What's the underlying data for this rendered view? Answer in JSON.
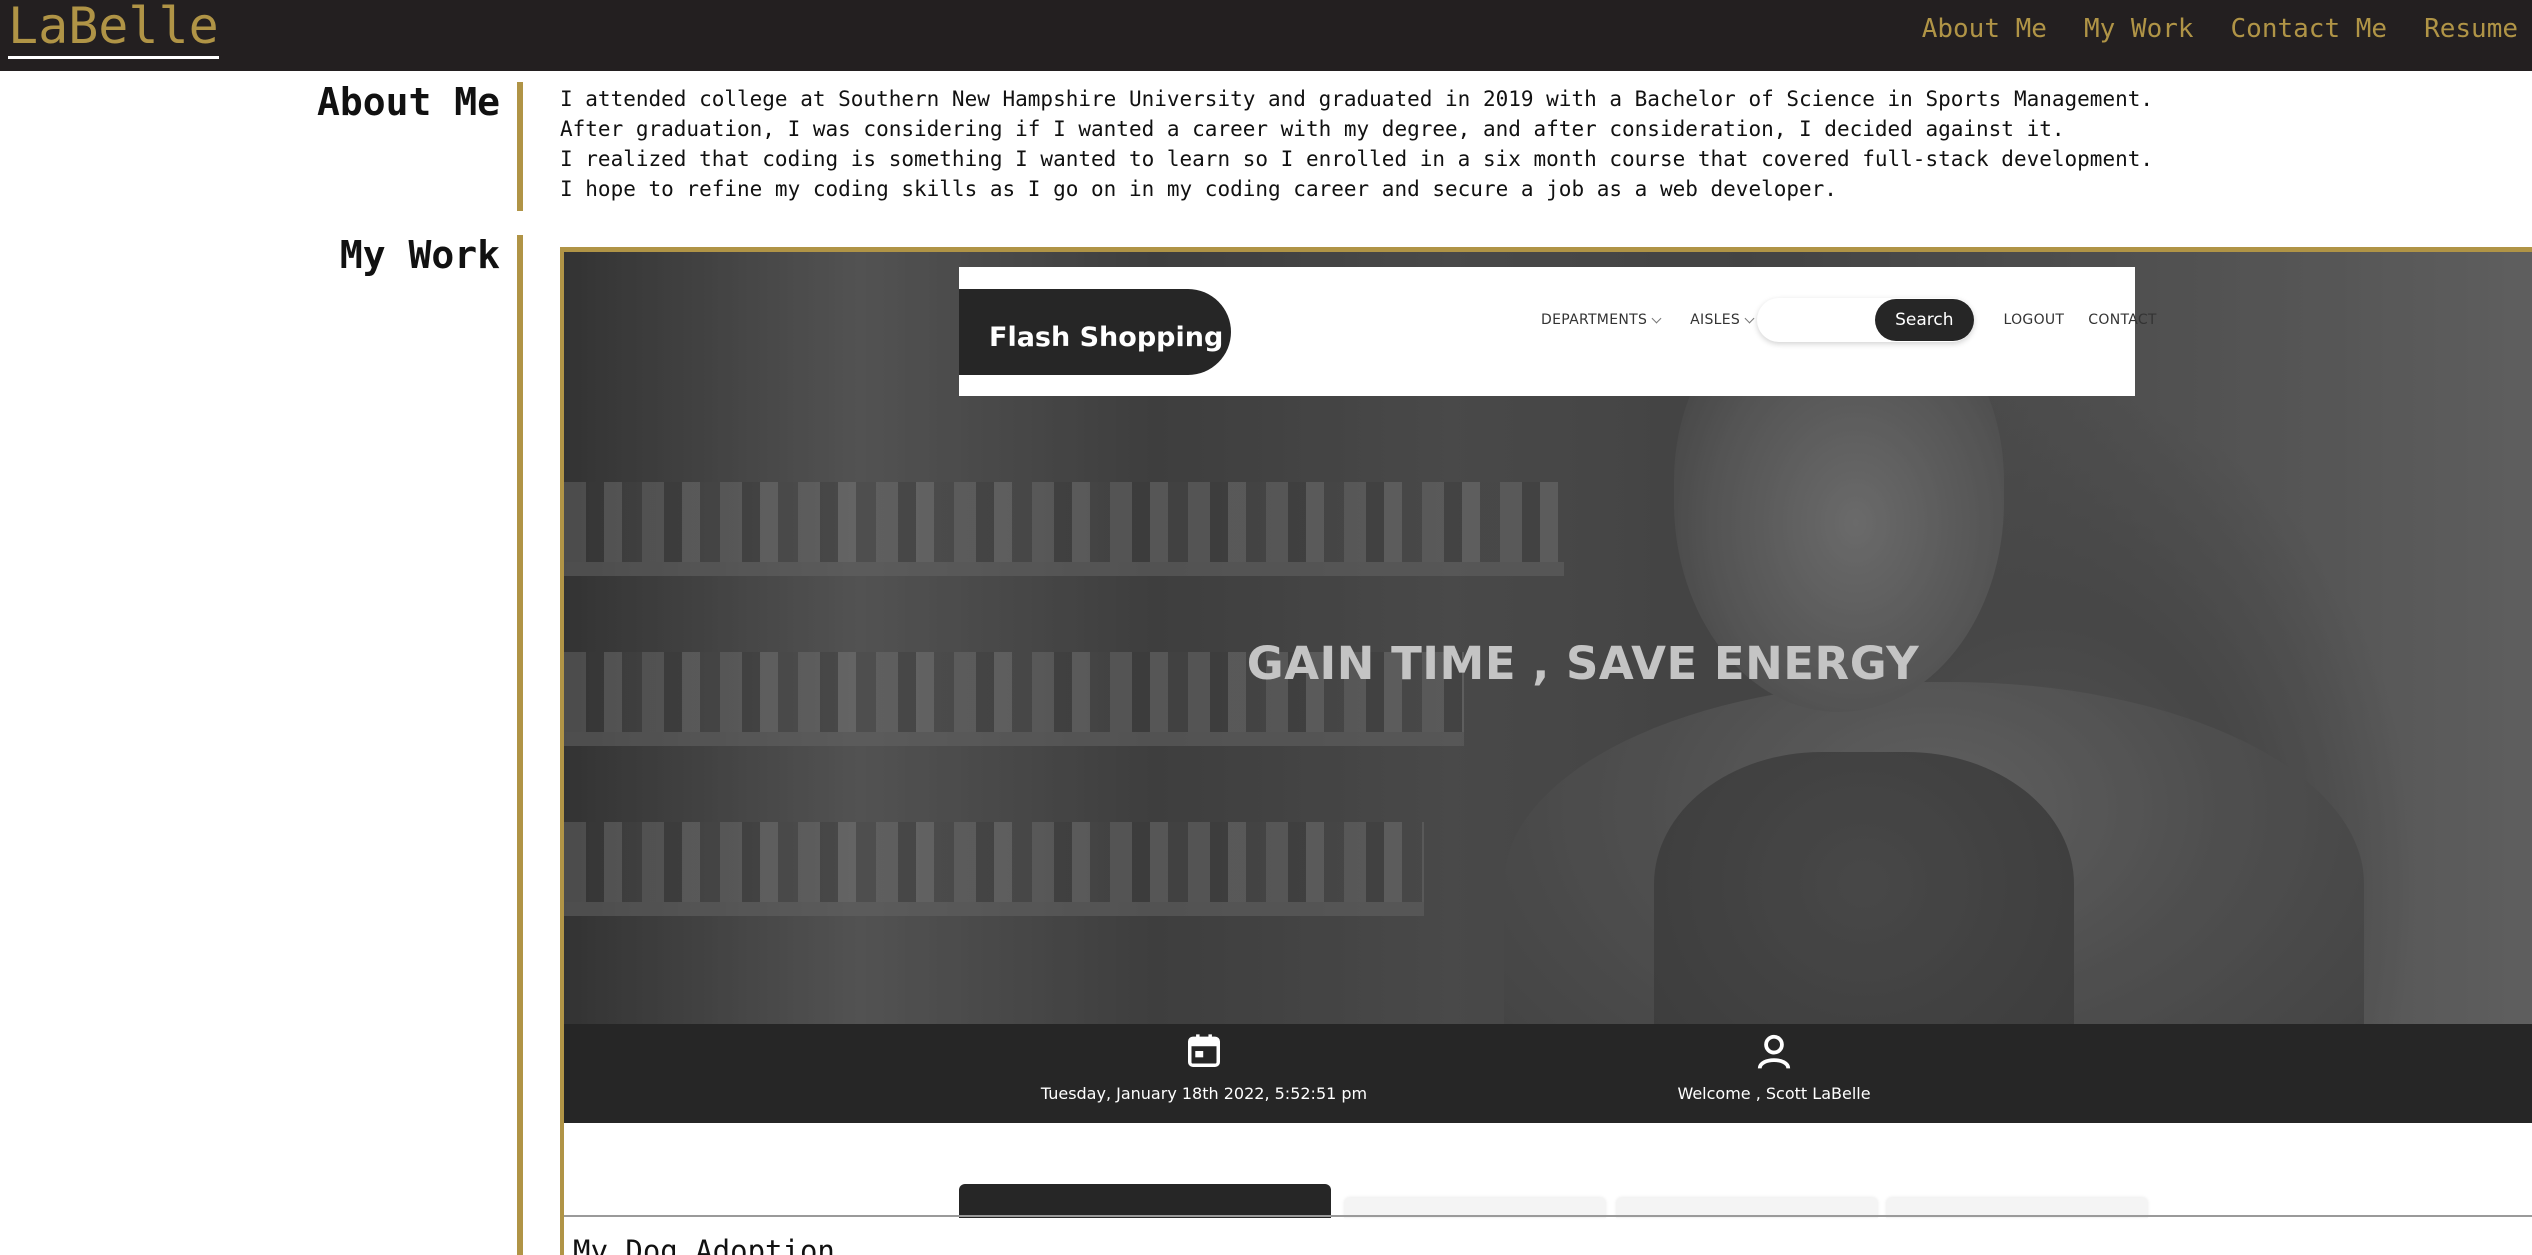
{
  "brand": "LaBelle",
  "nav": {
    "links": [
      "About Me",
      "My Work",
      "Contact Me",
      "Resume"
    ]
  },
  "about": {
    "title": "About Me",
    "lines": [
      "I attended college at Southern New Hampshire University and graduated in 2019 with a Bachelor of Science in Sports Management.",
      "After graduation, I was considering if I wanted a career with my degree, and after consideration, I decided against it.",
      "I realized that coding is something I wanted to learn so I enrolled in a six month course that covered full-stack development.",
      "I hope to refine my coding skills as I go on in my coding career and secure a job as a web developer."
    ]
  },
  "work": {
    "title": "My Work",
    "preview": {
      "logo": "Flash Shopping",
      "departments": "DEPARTMENTS",
      "aisles": "AISLES",
      "search_placeholder": "",
      "search_button": "Search",
      "logout": "LOGOUT",
      "contact": "CONTACT",
      "hero_title": "GAIN TIME , SAVE ENERGY",
      "date_text": "Tuesday, January 18th 2022, 5:52:51 pm",
      "welcome_text": "Welcome , Scott LaBelle",
      "icons": [
        "calendar-icon",
        "user-icon"
      ]
    },
    "next_project_title": "My Dog Adoption"
  },
  "colors": {
    "accent": "#b09446",
    "navbar": "#231f20",
    "dark": "#262626"
  }
}
